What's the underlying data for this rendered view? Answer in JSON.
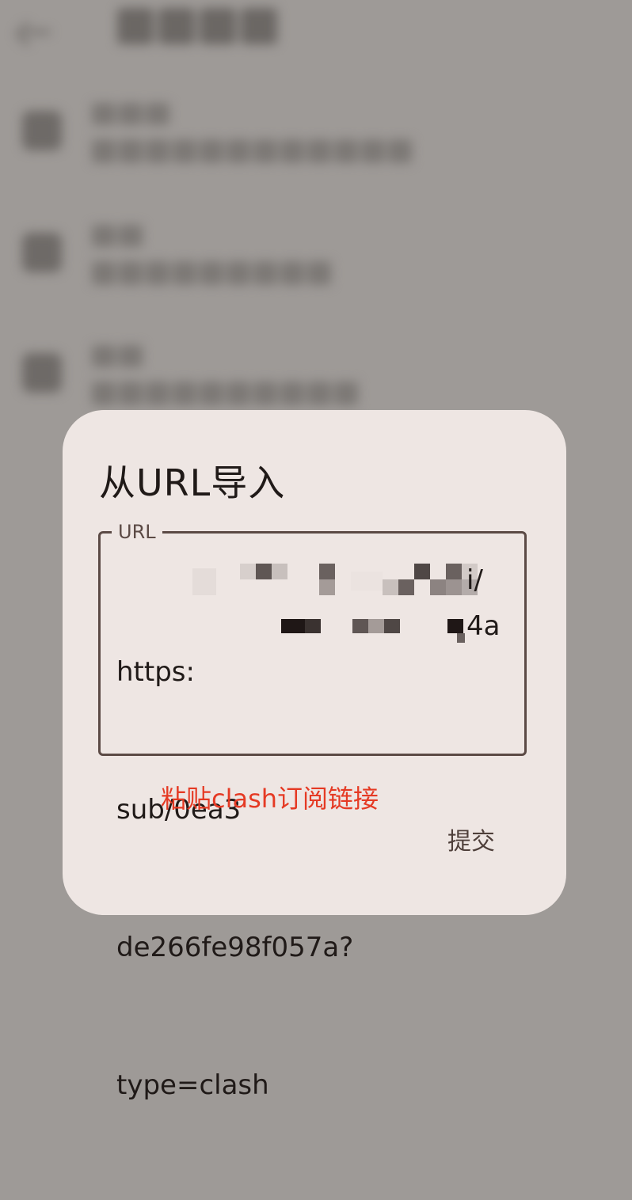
{
  "dialog": {
    "title": "从URL导入",
    "url_field": {
      "label": "URL",
      "value_lines": [
        "https:",
        "sub/0ea3",
        "de266fe98f057a?",
        "type=clash"
      ],
      "line1_tail": "i/",
      "line2_tail": "4a"
    },
    "helper_text": "粘贴clash订阅链接",
    "submit_label": "提交"
  },
  "colors": {
    "scrim": "#9e9a97",
    "dialog_bg": "#eee6e3",
    "outline": "#5b4a45",
    "error": "#e53a24",
    "text": "#201a18"
  }
}
